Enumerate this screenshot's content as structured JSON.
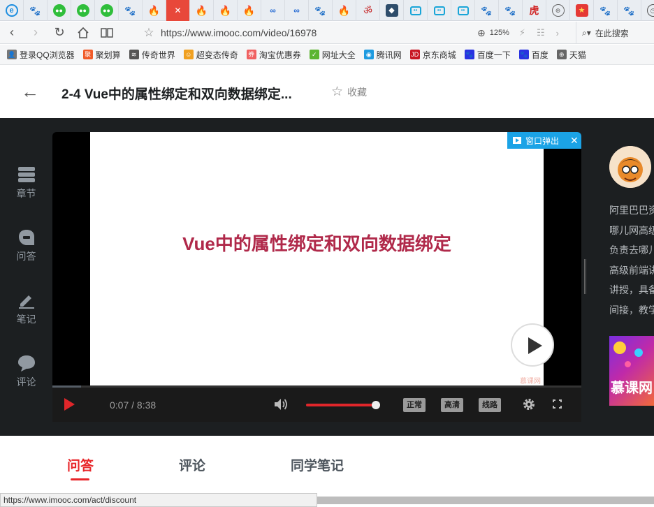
{
  "browser": {
    "tabs": [
      {
        "icon": "ie-icon",
        "glyph": "e",
        "kind": "t-ie"
      },
      {
        "icon": "baidu-paw-icon",
        "glyph": "🐾",
        "kind": "t-baidu"
      },
      {
        "icon": "wechat-icon",
        "glyph": "●●",
        "kind": "t-wechat"
      },
      {
        "icon": "wechat-icon",
        "glyph": "●●",
        "kind": "t-wechat"
      },
      {
        "icon": "wechat-icon",
        "glyph": "●●",
        "kind": "t-wechat"
      },
      {
        "icon": "baidu-paw-icon",
        "glyph": "🐾",
        "kind": "t-baidu"
      },
      {
        "icon": "flame-icon",
        "glyph": "🔥",
        "kind": "t-fire"
      },
      {
        "icon": "close-icon",
        "glyph": "✕",
        "kind": "active"
      },
      {
        "icon": "flame-icon",
        "glyph": "🔥",
        "kind": "t-fire"
      },
      {
        "icon": "flame-icon",
        "glyph": "🔥",
        "kind": "t-fire"
      },
      {
        "icon": "flame-icon",
        "glyph": "🔥",
        "kind": "t-fire"
      },
      {
        "icon": "link-icon",
        "glyph": "∞",
        "kind": "t-link"
      },
      {
        "icon": "link-icon",
        "glyph": "∞",
        "kind": "t-link"
      },
      {
        "icon": "baidu-paw-icon",
        "glyph": "🐾",
        "kind": "t-baidu"
      },
      {
        "icon": "flame-icon",
        "glyph": "🔥",
        "kind": "t-fire"
      },
      {
        "icon": "om-icon",
        "glyph": "ॐ",
        "kind": "t-om"
      },
      {
        "icon": "app-icon",
        "glyph": "◆",
        "kind": "t-dark"
      },
      {
        "icon": "bilibili-icon",
        "glyph": "••",
        "kind": "t-tv"
      },
      {
        "icon": "bilibili-icon",
        "glyph": "••",
        "kind": "t-tv"
      },
      {
        "icon": "bilibili-icon",
        "glyph": "••",
        "kind": "t-tv"
      },
      {
        "icon": "baidu-paw-icon",
        "glyph": "🐾",
        "kind": "t-baidu"
      },
      {
        "icon": "baidu-paw-icon",
        "glyph": "🐾",
        "kind": "t-baidu"
      },
      {
        "icon": "tiger-icon",
        "glyph": "虎",
        "kind": "t-tiger"
      },
      {
        "icon": "globe-icon",
        "glyph": "⊕",
        "kind": "t-globe"
      },
      {
        "icon": "star-badge-icon",
        "glyph": "★",
        "kind": "t-red"
      },
      {
        "icon": "baidu-paw-icon",
        "glyph": "🐾",
        "kind": "t-baidu"
      },
      {
        "icon": "baidu-paw-icon",
        "glyph": "🐾",
        "kind": "t-baidu"
      },
      {
        "icon": "clock-icon",
        "glyph": "◷",
        "kind": "t-clock"
      }
    ],
    "url": "https://www.imooc.com/video/16978",
    "zoom": "125%",
    "search_placeholder": "在此搜索",
    "bookmarks": [
      {
        "label": "登录QQ浏览器",
        "icon": "user-icon",
        "glyph": "👤",
        "color": "#777777"
      },
      {
        "label": "聚划算",
        "icon": "juhuasuan-icon",
        "glyph": "聚",
        "color": "#f05a28"
      },
      {
        "label": "传奇世界",
        "icon": "audio-wave-icon",
        "glyph": "≋",
        "color": "#555555"
      },
      {
        "label": "超变态传奇",
        "icon": "smile-icon",
        "glyph": "☺",
        "color": "#f0a020"
      },
      {
        "label": "淘宝优惠券",
        "icon": "coupon-icon",
        "glyph": "券",
        "color": "#f06060"
      },
      {
        "label": "网址大全",
        "icon": "hao123-icon",
        "glyph": "✓",
        "color": "#5cb531"
      },
      {
        "label": "腾讯网",
        "icon": "tencent-icon",
        "glyph": "◉",
        "color": "#1e9be0"
      },
      {
        "label": "京东商城",
        "icon": "jd-icon",
        "glyph": "JD",
        "color": "#c81623"
      },
      {
        "label": "百度一下",
        "icon": "baidu-paw-icon",
        "glyph": "🐾",
        "color": "#2932e1"
      },
      {
        "label": "百度",
        "icon": "baidu-paw-icon",
        "glyph": "🐾",
        "color": "#2932e1"
      },
      {
        "label": "天猫",
        "icon": "globe-icon",
        "glyph": "⊕",
        "color": "#666666"
      }
    ],
    "status_url": "https://www.imooc.com/act/discount"
  },
  "header": {
    "title": "2-4 Vue中的属性绑定和双向数据绑定...",
    "favorite_label": "收藏"
  },
  "sidebar": {
    "items": [
      {
        "label": "章节",
        "icon": "chapter-icon"
      },
      {
        "label": "问答",
        "icon": "qa-icon"
      },
      {
        "label": "笔记",
        "icon": "note-icon"
      },
      {
        "label": "评论",
        "icon": "comment-icon"
      }
    ]
  },
  "player": {
    "slide_text": "Vue中的属性绑定和双向数据绑定",
    "watermark": "慕课网",
    "popout_label": "窗口弹出",
    "time": "0:07 / 8:38",
    "progress_fraction": 0.0136,
    "volume_fraction": 1.0,
    "quality_options": [
      "正常",
      "高清",
      "线路"
    ]
  },
  "teacher": {
    "bio_lines": [
      "阿里巴巴资",
      "哪儿网高级",
      "负责去哪儿",
      "高级前端讲",
      "讲授，具备",
      "间接，教学"
    ]
  },
  "promo": {
    "text": "慕课网"
  },
  "content_tabs": [
    {
      "label": "问答",
      "active": true
    },
    {
      "label": "评论",
      "active": false
    },
    {
      "label": "同学笔记",
      "active": false
    }
  ],
  "colors": {
    "accent_red": "#e8262a",
    "slide_title": "#b0294a",
    "popout_blue": "#1ba3e6",
    "dark_bg": "#1c1f21"
  }
}
